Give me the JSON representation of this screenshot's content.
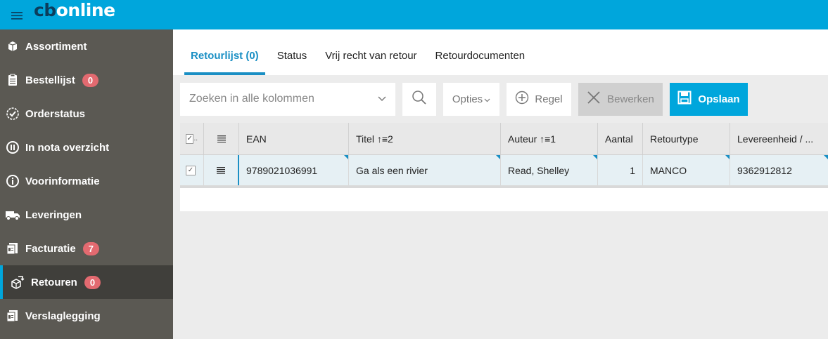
{
  "app": {
    "logo_dark": "cb",
    "logo_light": "online"
  },
  "sidebar": {
    "items": [
      {
        "label": "Assortiment",
        "icon": "box-icon",
        "badge": null
      },
      {
        "label": "Bestellijst",
        "icon": "clipboard-icon",
        "badge": "0"
      },
      {
        "label": "Orderstatus",
        "icon": "check-circle-icon",
        "badge": null
      },
      {
        "label": "In nota overzicht",
        "icon": "pause-circle-icon",
        "badge": null
      },
      {
        "label": "Voorinformatie",
        "icon": "info-circle-icon",
        "badge": null
      },
      {
        "label": "Leveringen",
        "icon": "truck-icon",
        "badge": null
      },
      {
        "label": "Facturatie",
        "icon": "invoice-icon",
        "badge": "7"
      },
      {
        "label": "Retouren",
        "icon": "return-box-icon",
        "badge": "0",
        "active": true
      },
      {
        "label": "Verslaglegging",
        "icon": "report-icon",
        "badge": null
      }
    ]
  },
  "tabs": [
    {
      "label": "Retourlijst (0)",
      "active": true
    },
    {
      "label": "Status"
    },
    {
      "label": "Vrij recht van retour"
    },
    {
      "label": "Retourdocumenten"
    }
  ],
  "toolbar": {
    "search_placeholder": "Zoeken in alle kolommen",
    "options_label": "Opties",
    "add_line_label": "Regel",
    "edit_label": "Bewerken",
    "save_label": "Opslaan"
  },
  "table": {
    "columns": [
      "EAN",
      "Titel ↑≡2",
      "Auteur ↑≡1",
      "Aantal",
      "Retourtype",
      "Levereenheid / ..."
    ],
    "rows": [
      {
        "ean": "9789021036991",
        "titel": "Ga als een rivier",
        "auteur": "Read, Shelley",
        "aantal": "1",
        "retourtype": "MANCO",
        "levereenheid": "9362912812"
      }
    ]
  },
  "colors": {
    "accent": "#00a6dc",
    "sidebar": "#5b5953",
    "badge": "#e36a70"
  }
}
